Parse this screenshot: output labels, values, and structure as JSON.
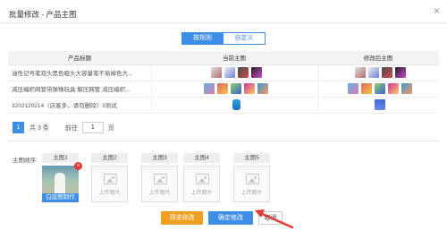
{
  "dialog": {
    "title": "批量修改 - 产品主图",
    "close_icon": "close-icon"
  },
  "tabs": [
    {
      "label": "按规则",
      "active": true
    },
    {
      "label": "自定义",
      "active": false
    }
  ],
  "table": {
    "headers": [
      "产品标题",
      "当前主图",
      "修改后主图"
    ],
    "rows": [
      {
        "title": "油性记号笔双头黑色粗头大容量笔不易掉色大...",
        "current_thumbs": 4,
        "modified_thumbs": 4
      },
      {
        "title": "减压编织网管带弹珠玩具 解压网管 减压编织...",
        "current_thumbs": 5,
        "modified_thumbs": 5
      },
      {
        "title": "3202120214（店客多，请勿删除）3测试",
        "current_thumbs": 1,
        "modified_thumbs": 1
      }
    ]
  },
  "pager": {
    "current_page": "1",
    "total_text": "共 3 条",
    "goto_label": "前往",
    "goto_value": "1",
    "page_suffix": "页"
  },
  "main_images": {
    "order_label": "主图顺序:",
    "slots": [
      {
        "label": "主图1",
        "has_image": true,
        "caption": "白底图制作"
      },
      {
        "label": "主图2",
        "has_image": false,
        "upload_text": "上传图片"
      },
      {
        "label": "主图3",
        "has_image": false,
        "upload_text": "上传图片"
      },
      {
        "label": "主图4",
        "has_image": false,
        "upload_text": "上传图片"
      },
      {
        "label": "主图5",
        "has_image": false,
        "upload_text": "上传图片"
      }
    ]
  },
  "buttons": {
    "preview": "预览修改",
    "confirm": "确定修改",
    "cancel": "取消"
  },
  "colors": {
    "primary": "#3d8ee6",
    "warning": "#f0a020",
    "danger": "#e53935",
    "arrow": "#e53935"
  }
}
